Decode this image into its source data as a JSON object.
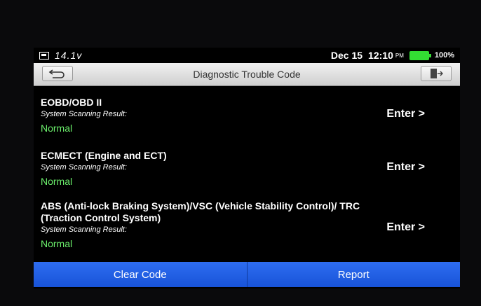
{
  "status": {
    "voltage": "14.1v",
    "date": "Dec 15",
    "time": "12:10",
    "ampm": "PM",
    "battery": "100%",
    "battery_level": 1.0,
    "vci_icon": "vci-connector-icon",
    "battery_color": "#33dd33"
  },
  "header": {
    "title": "Diagnostic Trouble Code",
    "back_icon": "back-arrow-icon",
    "exit_icon": "exit-icon"
  },
  "items": [
    {
      "name": "EOBD/OBD II",
      "subtitle": "System Scanning Result:",
      "status": "Normal",
      "action": "Enter >"
    },
    {
      "name": "ECMECT (Engine and ECT)",
      "subtitle": "System Scanning Result:",
      "status": "Normal",
      "action": "Enter >"
    },
    {
      "name": "ABS (Anti-lock Braking System)/VSC (Vehicle Stability Control)/ TRC (Traction Control System)",
      "subtitle": "System Scanning Result:",
      "status": "Normal",
      "action": "Enter >"
    }
  ],
  "footer": {
    "clear_label": "Clear Code",
    "report_label": "Report",
    "accent": "#1f5fe6"
  },
  "colors": {
    "status_ok": "#6cf06c"
  }
}
